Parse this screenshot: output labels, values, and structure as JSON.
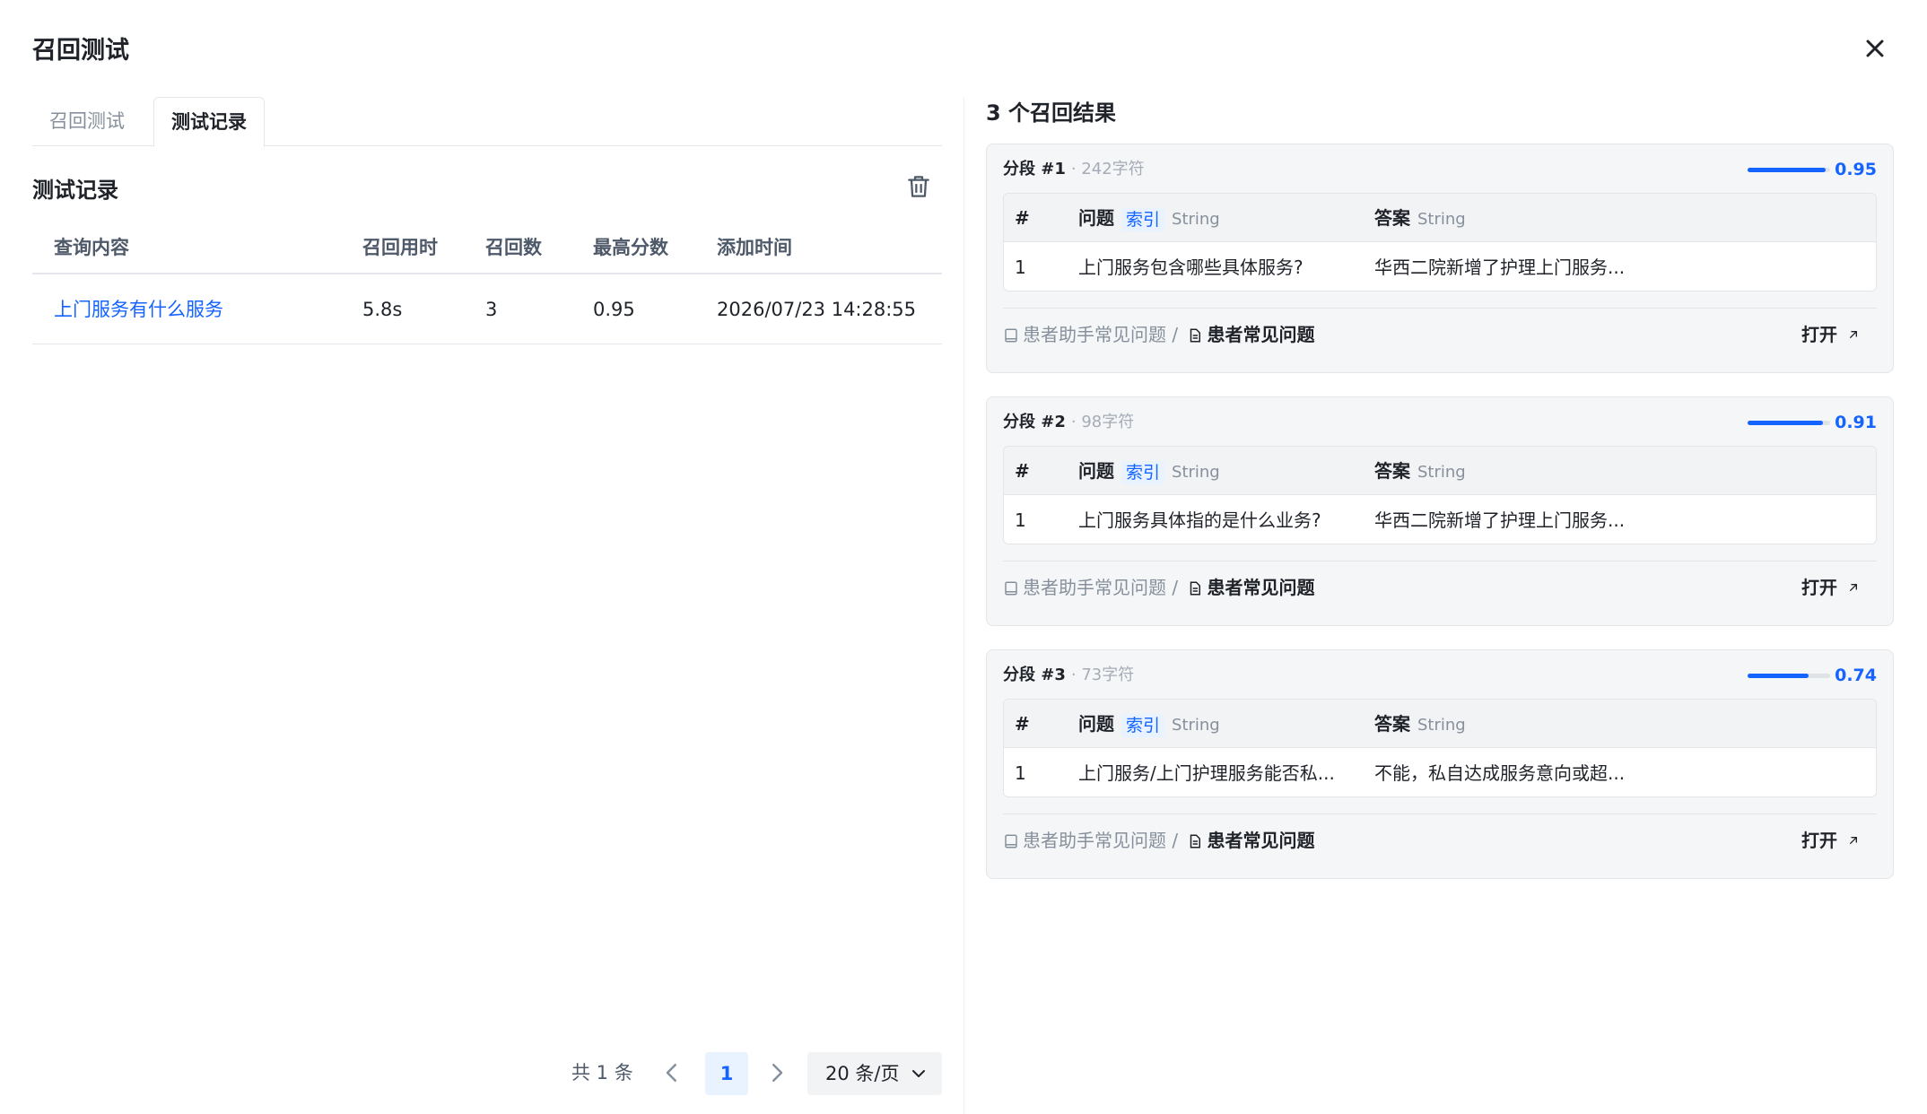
{
  "modal": {
    "title": "召回测试"
  },
  "tabs": [
    {
      "label": "召回测试",
      "active": false
    },
    {
      "label": "测试记录",
      "active": true
    }
  ],
  "records": {
    "title": "测试记录",
    "columns": [
      "查询内容",
      "召回用时",
      "召回数",
      "最高分数",
      "添加时间"
    ],
    "rows": [
      {
        "query": "上门服务有什么服务",
        "duration": "5.8s",
        "count": "3",
        "top_score": "0.95",
        "added_at": "2026/07/23 14:28:55"
      }
    ]
  },
  "pagination": {
    "total": "共 1 条",
    "current": "1",
    "page_size": "20 条/页"
  },
  "results": {
    "title": "3 个召回结果",
    "items": [
      {
        "segment": "分段 #1",
        "chars": "· 242字符",
        "score": 0.95,
        "score_text": "0.95",
        "col_num": "#",
        "col_question": "问题",
        "index_tag": "索引",
        "question_type": "String",
        "col_answer": "答案",
        "answer_type": "String",
        "row_num": "1",
        "question": "上门服务包含哪些具体服务?",
        "answer": "华西二院新增了护理上门服务...",
        "kb": "患者助手常见问题",
        "sep": "/",
        "doc": "患者常见问题",
        "open": "打开"
      },
      {
        "segment": "分段 #2",
        "chars": "· 98字符",
        "score": 0.91,
        "score_text": "0.91",
        "col_num": "#",
        "col_question": "问题",
        "index_tag": "索引",
        "question_type": "String",
        "col_answer": "答案",
        "answer_type": "String",
        "row_num": "1",
        "question": "上门服务具体指的是什么业务?",
        "answer": "华西二院新增了护理上门服务...",
        "kb": "患者助手常见问题",
        "sep": "/",
        "doc": "患者常见问题",
        "open": "打开"
      },
      {
        "segment": "分段 #3",
        "chars": "· 73字符",
        "score": 0.74,
        "score_text": "0.74",
        "col_num": "#",
        "col_question": "问题",
        "index_tag": "索引",
        "question_type": "String",
        "col_answer": "答案",
        "answer_type": "String",
        "row_num": "1",
        "question": "上门服务/上门护理服务能否私...",
        "answer": "不能，私自达成服务意向或超...",
        "kb": "患者助手常见问题",
        "sep": "/",
        "doc": "患者常见问题",
        "open": "打开"
      }
    ]
  },
  "colors": {
    "accent": "#1664ff",
    "accent_bg": "#e8f3ff",
    "card_bg": "#f5f6f7"
  },
  "icons": {
    "close": "close-icon",
    "trash": "trash-icon",
    "prev": "chevron-left-icon",
    "next": "chevron-right-icon",
    "dropdown": "chevron-down-icon",
    "kb": "book-icon",
    "doc": "document-icon",
    "open": "external-link-icon"
  }
}
